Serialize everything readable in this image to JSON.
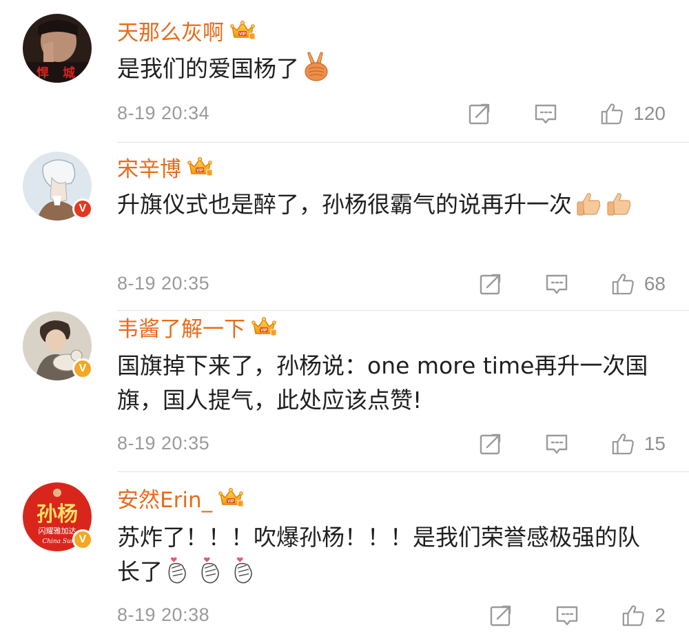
{
  "colors": {
    "username": "#e86b1a",
    "text": "#1f1f1f",
    "meta": "#9a9a9a",
    "divider": "#e3e3e3",
    "verified_badge": "#f5a623",
    "verified_badge_red": "#e3381f"
  },
  "comments": [
    {
      "username": "天那么灰啊",
      "text": "是我们的爱国杨了",
      "emoji": "victory-hand-emoji",
      "time": "8-19 20:34",
      "likes": "120",
      "verified": false
    },
    {
      "username": "宋辛博",
      "text": "升旗仪式也是醉了，孙杨很霸气的说再升一次",
      "emoji": "thumbs-up-emoji",
      "time": "8-19 20:35",
      "likes": "68",
      "verified": true
    },
    {
      "username": "韦酱了解一下",
      "text": "国旗掉下来了，孙杨说：one more time再升一次国旗，国人提气，此处应该点赞!",
      "time": "8-19 20:35",
      "likes": "15",
      "verified": true
    },
    {
      "username": "安然Erin_",
      "text": "苏炸了！！！吹爆孙杨！！！是我们荣誉感极强的队长了",
      "emoji": "finger-heart-emoji",
      "time": "8-19 20:38",
      "likes": "2",
      "verified": true,
      "avatar_text_main": "孙杨",
      "avatar_text_sub": "闪耀雅加达",
      "avatar_text_en": "China Sun"
    }
  ]
}
